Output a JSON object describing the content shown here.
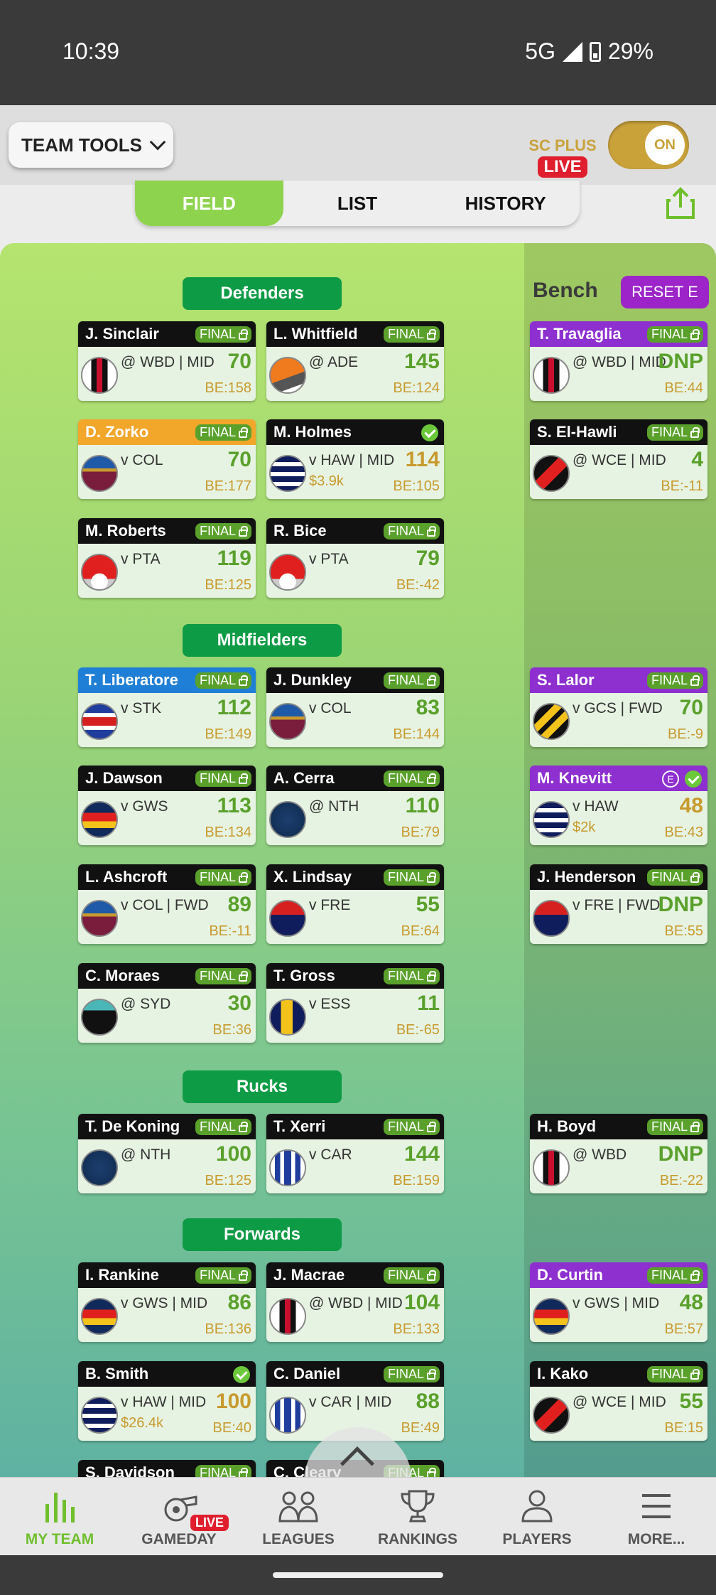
{
  "status_bar": {
    "time": "10:39",
    "network": "5G",
    "battery": "29%"
  },
  "toolbar": {
    "team_tools_label": "TEAM TOOLS",
    "sc_plus_label": "SC PLUS",
    "live_label": "LIVE",
    "toggle_label": "ON"
  },
  "view_tabs": [
    "FIELD",
    "LIST",
    "HISTORY"
  ],
  "active_view": "FIELD",
  "bench": {
    "heading": "Bench",
    "reset_label": "RESET E"
  },
  "positions": {
    "defenders": "Defenders",
    "midfielders": "Midfielders",
    "rucks": "Rucks",
    "forwards": "Forwards"
  },
  "colors": {
    "accent_green": "#8ed34e",
    "final_green": "#5aa12c",
    "live_red": "#e01e2e",
    "gold": "#c9a23a",
    "bench_purple": "#9c24c9"
  },
  "players": [
    {
      "name": "J. Sinclair",
      "status": "FINAL",
      "match": "@ WBD | MID",
      "score": "70",
      "be": "BE:158",
      "header": "black",
      "guernsey": "stripe-rwb",
      "section": "defenders"
    },
    {
      "name": "L. Whitfield",
      "status": "FINAL",
      "match": "@ ADE",
      "score": "145",
      "be": "BE:124",
      "header": "black",
      "guernsey": "orange-charcoal",
      "section": "defenders"
    },
    {
      "name": "D. Zorko",
      "status": "FINAL",
      "match": "v COL",
      "score": "70",
      "be": "BE:177",
      "header": "orange",
      "guernsey": "maroon-blue",
      "section": "defenders"
    },
    {
      "name": "M. Holmes",
      "status": "tick",
      "match": "v HAW | MID",
      "price": "$3.9k",
      "score": "114",
      "be": "BE:105",
      "header": "black",
      "guernsey": "navy-hoops",
      "section": "defenders",
      "score_gold": true
    },
    {
      "name": "M. Roberts",
      "status": "FINAL",
      "match": "v PTA",
      "score": "119",
      "be": "BE:125",
      "header": "black",
      "guernsey": "red-white",
      "section": "defenders"
    },
    {
      "name": "R. Bice",
      "status": "FINAL",
      "match": "v PTA",
      "score": "79",
      "be": "BE:-42",
      "header": "black",
      "guernsey": "red-white",
      "section": "defenders"
    },
    {
      "name": "T. Liberatore",
      "status": "FINAL",
      "match": "v STK",
      "score": "112",
      "be": "BE:149",
      "header": "blue",
      "guernsey": "red-white-blue",
      "section": "midfielders"
    },
    {
      "name": "J. Dunkley",
      "status": "FINAL",
      "match": "v COL",
      "score": "83",
      "be": "BE:144",
      "header": "black",
      "guernsey": "maroon-blue",
      "section": "midfielders"
    },
    {
      "name": "J. Dawson",
      "status": "FINAL",
      "match": "v GWS",
      "score": "113",
      "be": "BE:134",
      "header": "black",
      "guernsey": "adelaide",
      "section": "midfielders"
    },
    {
      "name": "A. Cerra",
      "status": "FINAL",
      "match": "@ NTH",
      "score": "110",
      "be": "BE:79",
      "header": "black",
      "guernsey": "navy",
      "section": "midfielders"
    },
    {
      "name": "L. Ashcroft",
      "status": "FINAL",
      "match": "v COL | FWD",
      "score": "89",
      "be": "BE:-11",
      "header": "black",
      "guernsey": "maroon-blue",
      "section": "midfielders"
    },
    {
      "name": "X. Lindsay",
      "status": "FINAL",
      "match": "v FRE",
      "score": "55",
      "be": "BE:64",
      "header": "black",
      "guernsey": "melbourne",
      "section": "midfielders"
    },
    {
      "name": "C. Moraes",
      "status": "FINAL",
      "match": "@ SYD",
      "score": "30",
      "be": "BE:36",
      "header": "black",
      "guernsey": "port",
      "section": "midfielders"
    },
    {
      "name": "T. Gross",
      "status": "FINAL",
      "match": "v ESS",
      "score": "11",
      "be": "BE:-65",
      "header": "black",
      "guernsey": "navy-gold",
      "section": "midfielders"
    },
    {
      "name": "T. De Koning",
      "status": "FINAL",
      "match": "@ NTH",
      "score": "100",
      "be": "BE:125",
      "header": "black",
      "guernsey": "navy",
      "section": "rucks"
    },
    {
      "name": "T. Xerri",
      "status": "FINAL",
      "match": "v CAR",
      "score": "144",
      "be": "BE:159",
      "header": "black",
      "guernsey": "blue-stripes",
      "section": "rucks"
    },
    {
      "name": "I. Rankine",
      "status": "FINAL",
      "match": "v GWS | MID",
      "score": "86",
      "be": "BE:136",
      "header": "black",
      "guernsey": "adelaide",
      "section": "forwards"
    },
    {
      "name": "J. Macrae",
      "status": "FINAL",
      "match": "@ WBD | MID",
      "score": "104",
      "be": "BE:133",
      "header": "black",
      "guernsey": "stripe-rwb",
      "section": "forwards"
    },
    {
      "name": "B. Smith",
      "status": "tick",
      "match": "v HAW | MID",
      "price": "$26.4k",
      "score": "100",
      "be": "BE:40",
      "header": "black",
      "guernsey": "navy-hoops",
      "section": "forwards",
      "score_gold": true
    },
    {
      "name": "C. Daniel",
      "status": "FINAL",
      "match": "v CAR | MID",
      "score": "88",
      "be": "BE:49",
      "header": "black",
      "guernsey": "blue-stripes",
      "section": "forwards"
    },
    {
      "name": "S. Davidson",
      "status": "FINAL",
      "match": "",
      "score": "",
      "be": "",
      "header": "black",
      "guernsey": "navy",
      "section": "forwards"
    },
    {
      "name": "C. Cleary",
      "status": "FINAL",
      "match": "",
      "score": "",
      "be": "",
      "header": "black",
      "guernsey": "navy",
      "section": "forwards"
    }
  ],
  "bench_players": [
    {
      "name": "T. Travaglia",
      "status": "FINAL",
      "match": "@ WBD | MID",
      "score": "DNP",
      "be": "BE:44",
      "header": "purple",
      "guernsey": "stripe-rwb"
    },
    {
      "name": "S. El-Hawli",
      "status": "FINAL",
      "match": "@ WCE | MID",
      "score": "4",
      "be": "BE:-11",
      "header": "black",
      "guernsey": "essendon"
    },
    {
      "name": "S. Lalor",
      "status": "FINAL",
      "match": "v GCS | FWD",
      "score": "70",
      "be": "BE:-9",
      "header": "purple",
      "guernsey": "richmond"
    },
    {
      "name": "M. Knevitt",
      "status": "tick-e",
      "match": "v HAW",
      "price": "$2k",
      "score": "48",
      "be": "BE:43",
      "header": "purple",
      "guernsey": "navy-hoops",
      "score_gold": true
    },
    {
      "name": "J. Henderson",
      "status": "FINAL",
      "match": "v FRE | FWD",
      "score": "DNP",
      "be": "BE:55",
      "header": "black",
      "guernsey": "melbourne"
    },
    {
      "name": "H. Boyd",
      "status": "FINAL",
      "match": "@ WBD",
      "score": "DNP",
      "be": "BE:-22",
      "header": "black",
      "guernsey": "stripe-rwb"
    },
    {
      "name": "D. Curtin",
      "status": "FINAL",
      "match": "v GWS | MID",
      "score": "48",
      "be": "BE:57",
      "header": "purple",
      "guernsey": "adelaide"
    },
    {
      "name": "I. Kako",
      "status": "FINAL",
      "match": "@ WCE | MID",
      "score": "55",
      "be": "BE:15",
      "header": "black",
      "guernsey": "essendon"
    }
  ],
  "bottom_nav": [
    {
      "label": "MY TEAM",
      "icon": "bar-chart-icon",
      "active": true
    },
    {
      "label": "GAMEDAY",
      "icon": "whistle-icon",
      "badge": "LIVE"
    },
    {
      "label": "LEAGUES",
      "icon": "versus-icon"
    },
    {
      "label": "RANKINGS",
      "icon": "trophy-icon"
    },
    {
      "label": "PLAYERS",
      "icon": "person-icon"
    },
    {
      "label": "MORE...",
      "icon": "menu-icon"
    }
  ]
}
